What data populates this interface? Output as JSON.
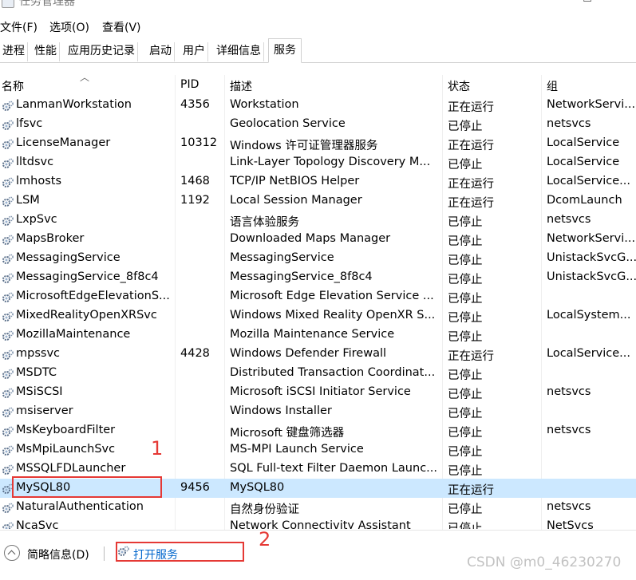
{
  "window": {
    "title": "任务管理器",
    "min": "—",
    "max": "☐"
  },
  "menu": [
    "文件(F)",
    "选项(O)",
    "查看(V)"
  ],
  "tabs": [
    "进程",
    "性能",
    "应用历史记录",
    "启动",
    "用户",
    "详细信息",
    "服务"
  ],
  "active_tab": "服务",
  "columns": {
    "name": "名称",
    "pid": "PID",
    "desc": "描述",
    "status": "状态",
    "group": "组"
  },
  "rows": [
    {
      "name": "LanmanWorkstation",
      "pid": "4356",
      "desc": "Workstation",
      "status": "正在运行",
      "group": "NetworkServi..."
    },
    {
      "name": "lfsvc",
      "pid": "",
      "desc": "Geolocation Service",
      "status": "已停止",
      "group": "netsvcs"
    },
    {
      "name": "LicenseManager",
      "pid": "10312",
      "desc": "Windows 许可证管理器服务",
      "status": "正在运行",
      "group": "LocalService"
    },
    {
      "name": "lltdsvc",
      "pid": "",
      "desc": "Link-Layer Topology Discovery M...",
      "status": "已停止",
      "group": "LocalService"
    },
    {
      "name": "lmhosts",
      "pid": "1468",
      "desc": "TCP/IP NetBIOS Helper",
      "status": "正在运行",
      "group": "LocalService..."
    },
    {
      "name": "LSM",
      "pid": "1192",
      "desc": "Local Session Manager",
      "status": "正在运行",
      "group": "DcomLaunch"
    },
    {
      "name": "LxpSvc",
      "pid": "",
      "desc": "语言体验服务",
      "status": "已停止",
      "group": "netsvcs"
    },
    {
      "name": "MapsBroker",
      "pid": "",
      "desc": "Downloaded Maps Manager",
      "status": "已停止",
      "group": "NetworkServi..."
    },
    {
      "name": "MessagingService",
      "pid": "",
      "desc": "MessagingService",
      "status": "已停止",
      "group": "UnistackSvcG..."
    },
    {
      "name": "MessagingService_8f8c4",
      "pid": "",
      "desc": "MessagingService_8f8c4",
      "status": "已停止",
      "group": "UnistackSvcG..."
    },
    {
      "name": "MicrosoftEdgeElevationS...",
      "pid": "",
      "desc": "Microsoft Edge Elevation Service ...",
      "status": "已停止",
      "group": ""
    },
    {
      "name": "MixedRealityOpenXRSvc",
      "pid": "",
      "desc": "Windows Mixed Reality OpenXR S...",
      "status": "已停止",
      "group": "LocalSystem..."
    },
    {
      "name": "MozillaMaintenance",
      "pid": "",
      "desc": "Mozilla Maintenance Service",
      "status": "已停止",
      "group": ""
    },
    {
      "name": "mpssvc",
      "pid": "4428",
      "desc": "Windows Defender Firewall",
      "status": "正在运行",
      "group": "LocalService..."
    },
    {
      "name": "MSDTC",
      "pid": "",
      "desc": "Distributed Transaction Coordinat...",
      "status": "已停止",
      "group": ""
    },
    {
      "name": "MSiSCSI",
      "pid": "",
      "desc": "Microsoft iSCSI Initiator Service",
      "status": "已停止",
      "group": "netsvcs"
    },
    {
      "name": "msiserver",
      "pid": "",
      "desc": "Windows Installer",
      "status": "已停止",
      "group": ""
    },
    {
      "name": "MsKeyboardFilter",
      "pid": "",
      "desc": "Microsoft 键盘筛选器",
      "status": "已停止",
      "group": "netsvcs"
    },
    {
      "name": "MsMpiLaunchSvc",
      "pid": "",
      "desc": "MS-MPI Launch Service",
      "status": "已停止",
      "group": ""
    },
    {
      "name": "MSSQLFDLauncher",
      "pid": "",
      "desc": "SQL Full-text Filter Daemon Launc...",
      "status": "已停止",
      "group": ""
    },
    {
      "name": "MySQL80",
      "pid": "9456",
      "desc": "MySQL80",
      "status": "正在运行",
      "group": "",
      "selected": true
    },
    {
      "name": "NaturalAuthentication",
      "pid": "",
      "desc": "自然身份验证",
      "status": "已停止",
      "group": "netsvcs"
    },
    {
      "name": "NcaSvc",
      "pid": "",
      "desc": "Network Connectivity Assistant",
      "status": "已停止",
      "group": "NetSvcs"
    }
  ],
  "bottom": {
    "brief": "简略信息(D)",
    "open_services": "打开服务"
  },
  "annotations": {
    "one": "1",
    "two": "2"
  },
  "watermark": "CSDN @m0_46230270",
  "colors": {
    "selected_row": "#cce8ff",
    "annotation": "#e53935",
    "link": "#0066cc"
  }
}
